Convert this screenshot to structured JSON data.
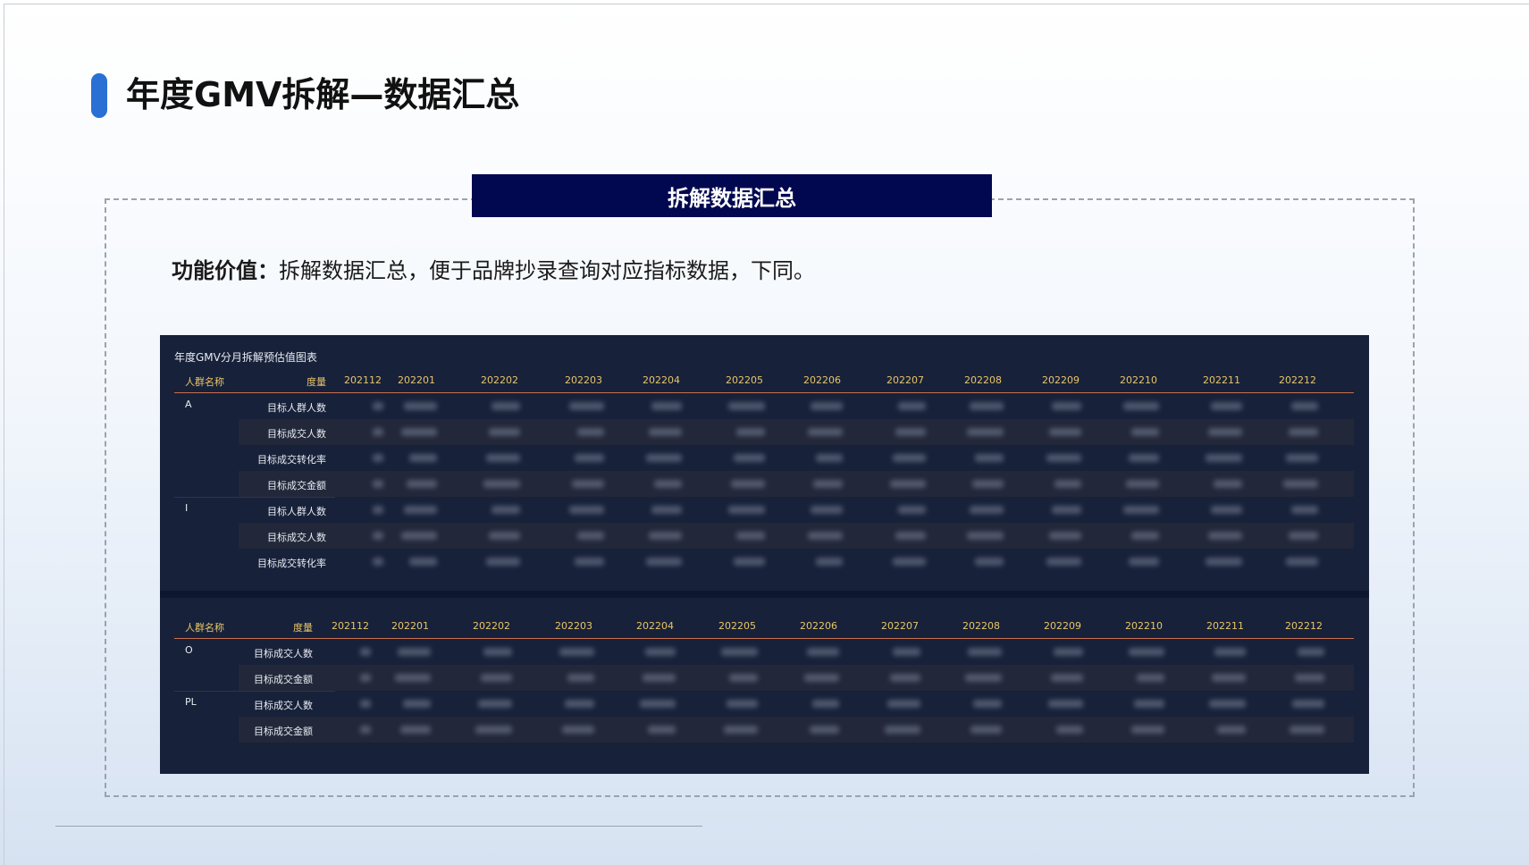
{
  "page": {
    "title": "年度GMV拆解—数据汇总"
  },
  "section": {
    "banner": "拆解数据汇总",
    "value_label": "功能价值：",
    "value_text": "拆解数据汇总，便于品牌抄录查询对应指标数据，下同。"
  },
  "panel": {
    "title": "年度GMV分月拆解预估值图表"
  },
  "table1": {
    "headers": [
      "人群名称",
      "度量",
      "202112",
      "202201",
      "202202",
      "202203",
      "202204",
      "202205",
      "202206",
      "202207",
      "202208",
      "202209",
      "202210",
      "202211",
      "202212"
    ],
    "groups": [
      {
        "name": "A",
        "metrics": [
          "目标人群人数",
          "目标成交人数",
          "目标成交转化率",
          "目标成交金额"
        ]
      },
      {
        "name": "I",
        "metrics": [
          "目标人群人数",
          "目标成交人数",
          "目标成交转化率"
        ]
      }
    ]
  },
  "table2": {
    "headers": [
      "人群名称",
      "度量",
      "202112",
      "202201",
      "202202",
      "202203",
      "202204",
      "202205",
      "202206",
      "202207",
      "202208",
      "202209",
      "202210",
      "202211",
      "202212"
    ],
    "groups": [
      {
        "name": "O",
        "metrics": [
          "目标成交人数",
          "目标成交金额"
        ]
      },
      {
        "name": "PL",
        "metrics": [
          "目标成交人数",
          "目标成交金额"
        ]
      }
    ]
  }
}
